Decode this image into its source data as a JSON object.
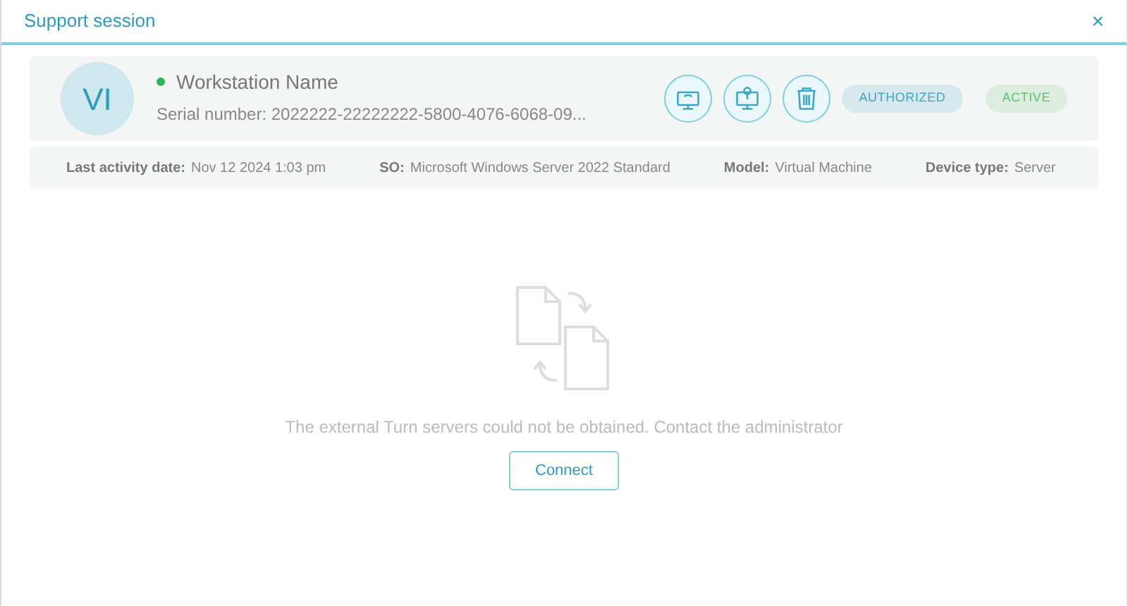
{
  "window": {
    "title": "Support session",
    "close": "×"
  },
  "device": {
    "avatar": "VI",
    "online": true,
    "name": "Workstation Name",
    "serial": "Serial number: 2022222-22222222-5800-4076-6068-09...",
    "actions": [
      {
        "kind": "remote"
      },
      {
        "kind": "push"
      },
      {
        "kind": "delete"
      }
    ],
    "badges": [
      {
        "label": "AUTHORIZED",
        "color": "#3aa6c9"
      },
      {
        "label": "ACTIVE",
        "color": "#5cc468"
      }
    ]
  },
  "details": [
    {
      "label": "Last activity date:",
      "value": "Nov 12 2024 1:03 pm"
    },
    {
      "label": "SO:",
      "value": "Microsoft Windows Server 2022 Standard"
    },
    {
      "label": "Model:",
      "value": "Virtual Machine"
    },
    {
      "label": "Device type:",
      "value": "Server"
    }
  ],
  "message": "The external Turn servers could not be obtained. Contact the administrator",
  "connect_button": "Connect"
}
